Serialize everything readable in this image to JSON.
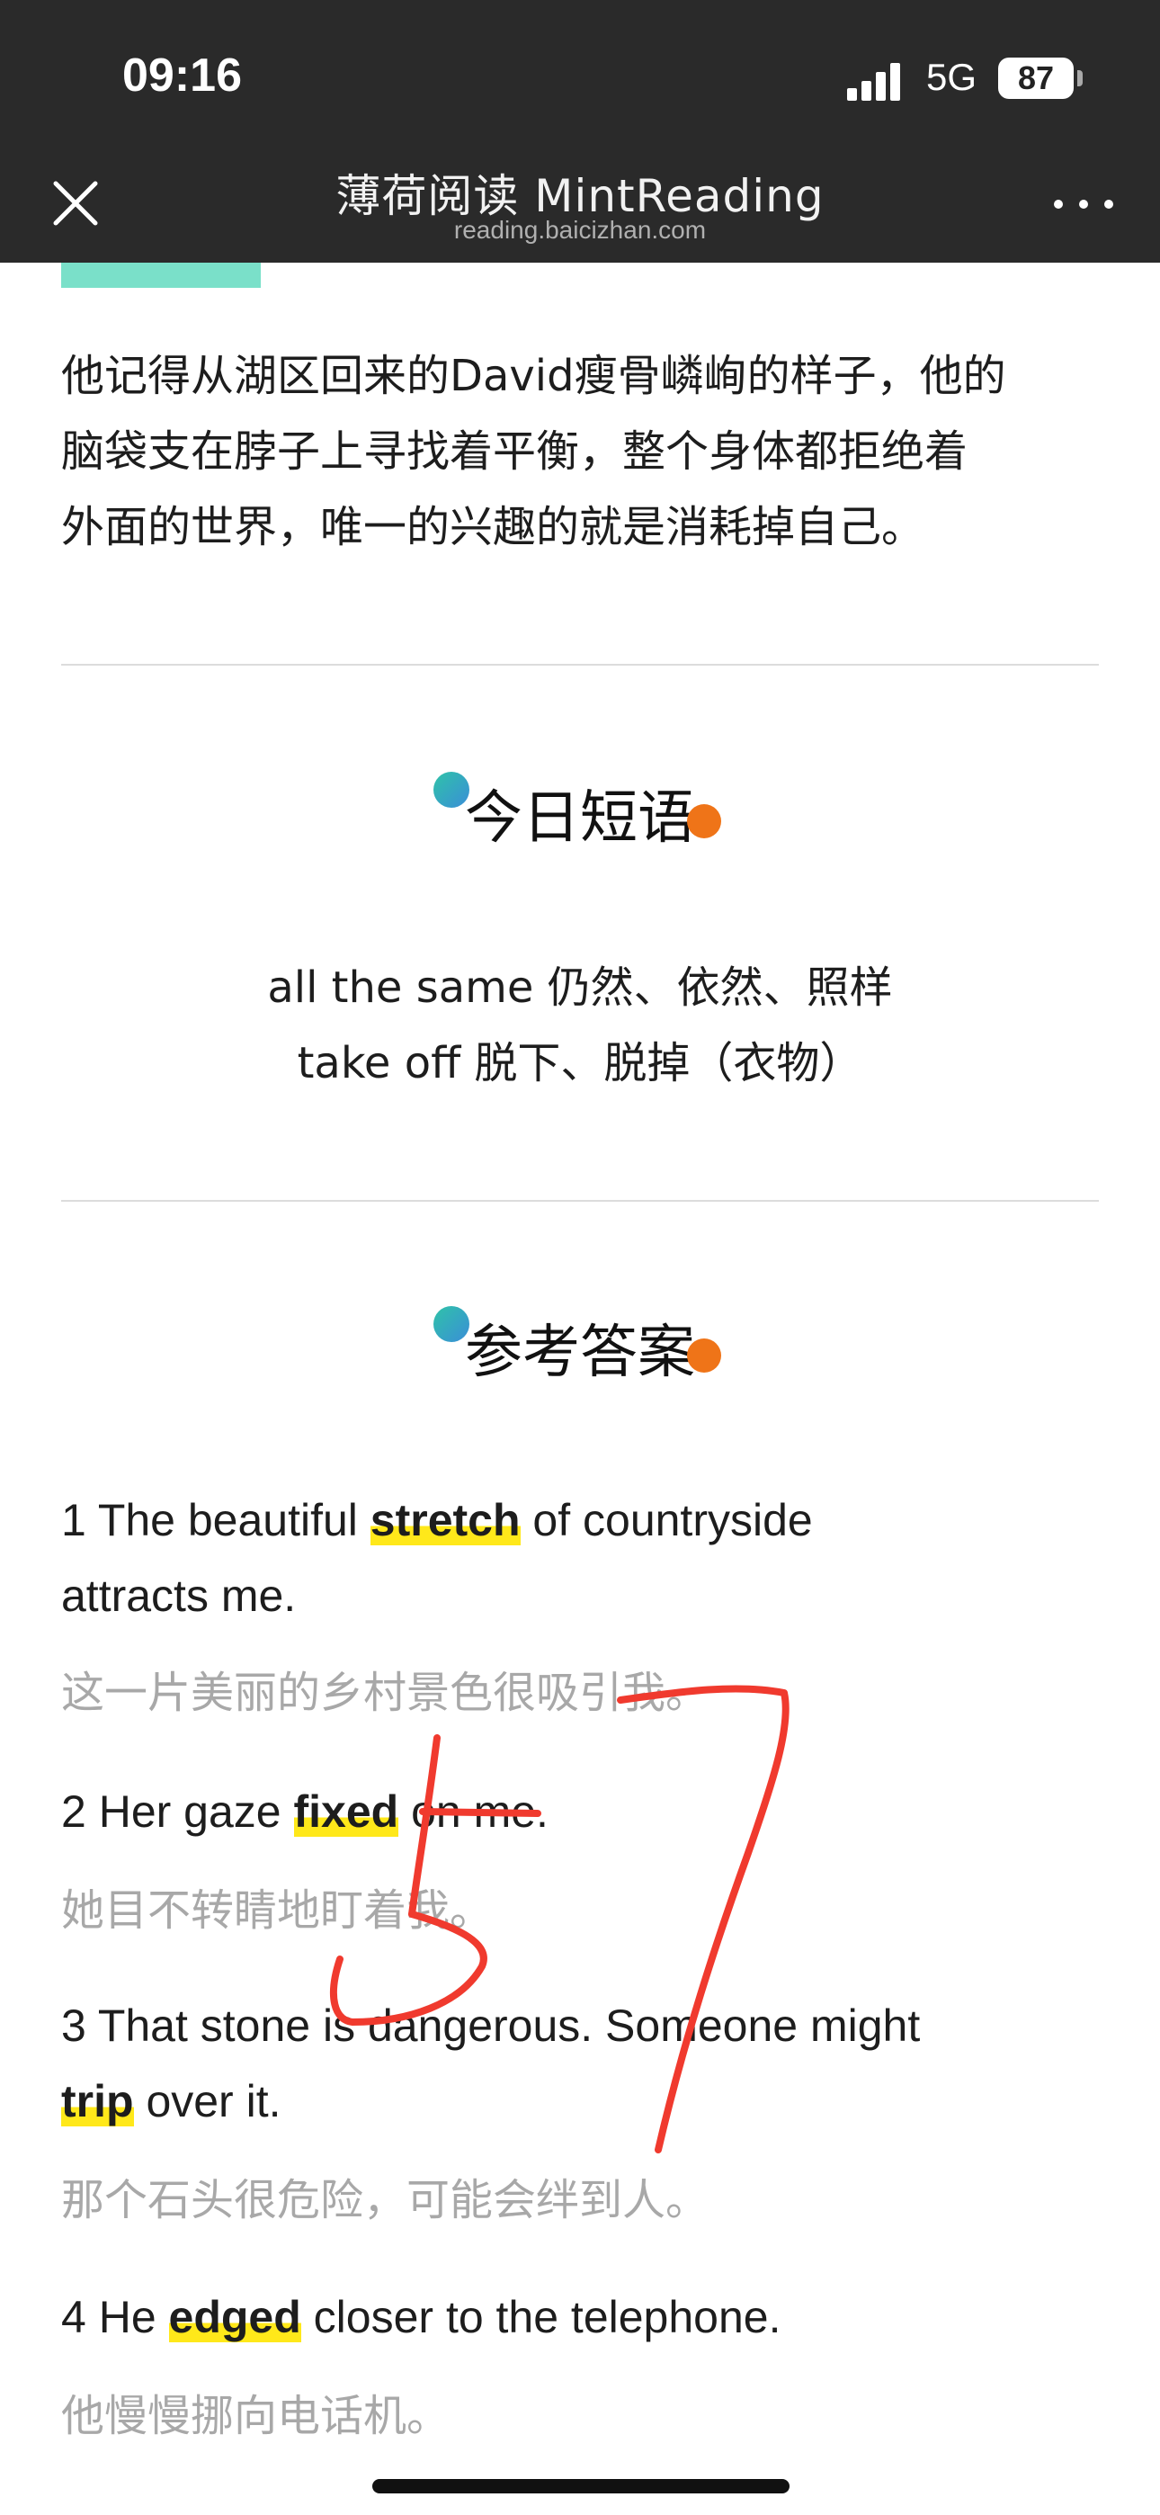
{
  "status_bar": {
    "time": "09:16",
    "network": "5G",
    "battery": "87"
  },
  "nav": {
    "title": "薄荷阅读 MintReading",
    "url": "reading.baicizhan.com"
  },
  "paragraph": {
    "lines": [
      "他记得从湖区回来的David瘦骨嶙峋的样子，他的",
      "脑袋支在脖子上寻找着平衡，整个身体都拒绝着",
      "外面的世界，唯一的兴趣的就是消耗掉自己。"
    ]
  },
  "phrases_section": {
    "title": "今日短语",
    "items": [
      "all the same 仍然、依然、照样",
      "take off 脱下、脱掉（衣物）"
    ]
  },
  "answers_section": {
    "title": "参考答案",
    "items": [
      {
        "n": "1",
        "pre": "The beautiful ",
        "word": "stretch",
        "post": " of countryside",
        "line2": "attracts me.",
        "zh": "这一片美丽的乡村景色很吸引我。"
      },
      {
        "n": "2",
        "pre": "Her gaze ",
        "word": "fixed",
        "post": " on me.",
        "zh": "她目不转睛地盯着我。"
      },
      {
        "n": "3",
        "pre": "That stone is dangerous. Someone might",
        "word": "trip",
        "post": " over it.",
        "zh": "那个石头很危险，可能会绊到人。"
      },
      {
        "n": "4",
        "pre": "He ",
        "word": "edged",
        "post": " closer to the telephone.",
        "zh": "他慢慢挪向电话机。"
      }
    ]
  },
  "colors": {
    "accent_teal": "#7ae0c9",
    "highlight": "#ffe81a",
    "dot_orange": "#ef7418",
    "ink_red": "#f03a2e"
  },
  "annotation": {
    "handwritten_marks": "57"
  }
}
